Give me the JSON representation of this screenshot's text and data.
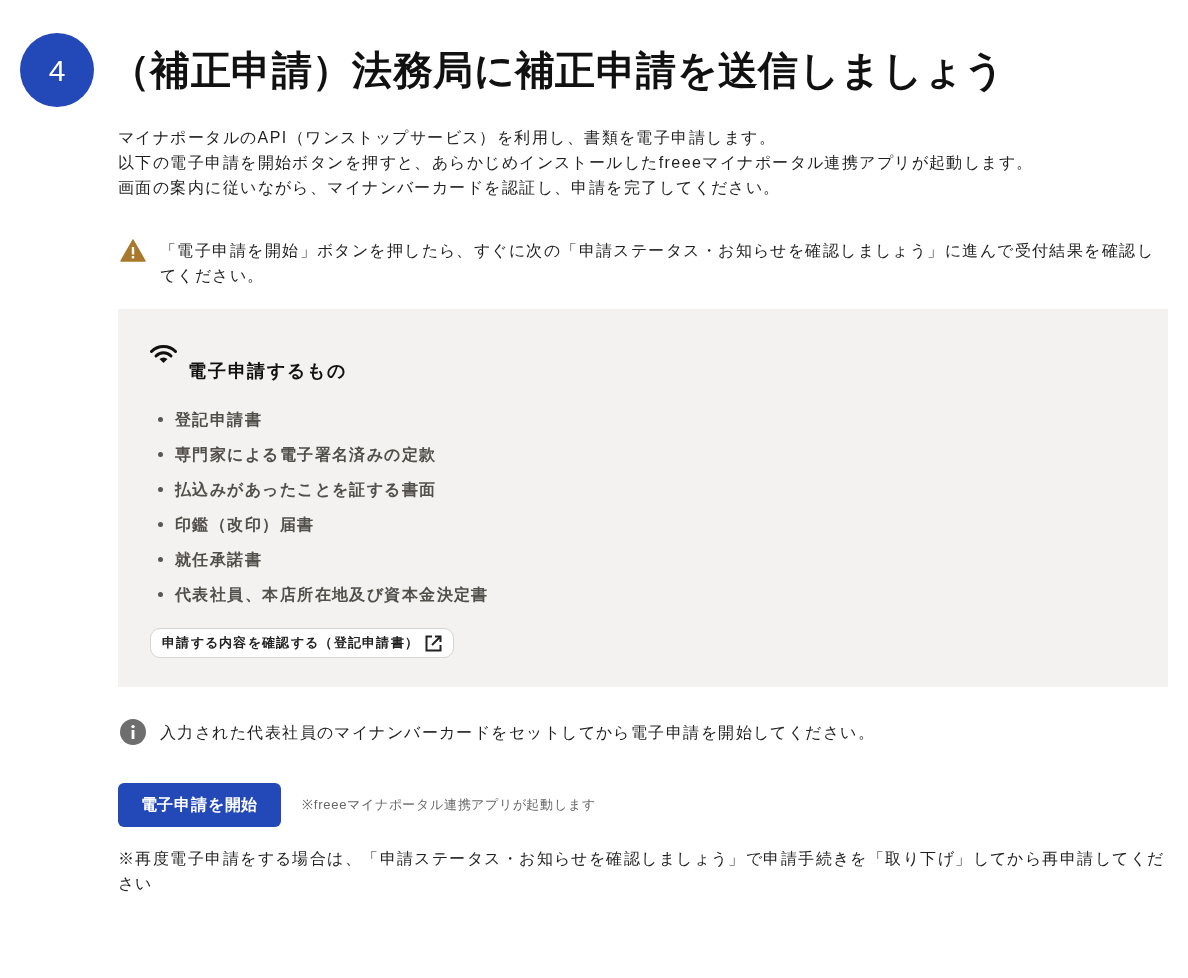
{
  "step": {
    "number": "4",
    "title": "（補正申請）法務局に補正申請を送信しましょう"
  },
  "intro": [
    "マイナポータルのAPI（ワンストップサービス）を利用し、書類を電子申請します。",
    "以下の電子申請を開始ボタンを押すと、あらかじめインストールしたfreeeマイナポータル連携アプリが起動します。",
    "画面の案内に従いながら、マイナンバーカードを認証し、申請を完了してください。"
  ],
  "warning": {
    "text": "「電子申請を開始」ボタンを押したら、すぐに次の「申請ステータス・お知らせを確認しましょう」に進んで受付結果を確認してください。"
  },
  "documents_panel": {
    "heading": "電子申請するもの",
    "items": [
      "登記申請書",
      "専門家による電子署名済みの定款",
      "払込みがあったことを証する書面",
      "印鑑（改印）届書",
      "就任承諾書",
      "代表社員、本店所在地及び資本金決定書"
    ],
    "link_button": "申請する内容を確認する（登記申請書）"
  },
  "info": {
    "text": "入力された代表社員のマイナンバーカードをセットしてから電子申請を開始してください。"
  },
  "submit_button": {
    "label": "電子申請を開始"
  },
  "submit_note": "※freeeマイナポータル連携アプリが起動します",
  "footer_note": "※再度電子申請をする場合は、「申請ステータス・お知らせを確認しましょう」で申請手続きを「取り下げ」してから再申請してください"
}
